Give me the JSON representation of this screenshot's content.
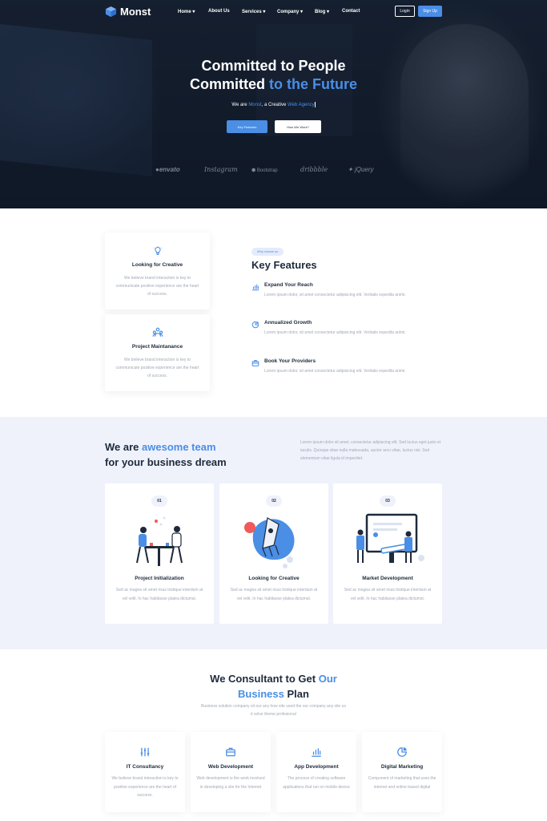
{
  "colors": {
    "accent": "#4a8ee5",
    "dark": "#1e2a3b",
    "muted": "#a0a8b5",
    "section_bg": "#eff2fb"
  },
  "brand": {
    "name": "Monst"
  },
  "nav": {
    "items": [
      {
        "label": "Home",
        "has_dropdown": true
      },
      {
        "label": "About Us",
        "has_dropdown": false
      },
      {
        "label": "Services",
        "has_dropdown": true
      },
      {
        "label": "Company",
        "has_dropdown": true
      },
      {
        "label": "Blog",
        "has_dropdown": true
      },
      {
        "label": "Contact",
        "has_dropdown": false
      }
    ],
    "login": "Login",
    "signup": "Sign Up"
  },
  "hero": {
    "line1": "Committed to People",
    "line2_plain": "Committed ",
    "line2_accent": "to the Future",
    "sub_pre": "We are ",
    "sub_brand": "Monst",
    "sub_mid": ", a Creative ",
    "sub_accent": "Web Agency",
    "btn_primary": "Key Features",
    "btn_secondary": "How We Work?",
    "partners": [
      "envato",
      "Instagram",
      "Bootstrap",
      "dribbble",
      "jQuery"
    ]
  },
  "features": {
    "cards": [
      {
        "icon": "lightbulb-icon",
        "title": "Looking for Creative",
        "text": "We believe brand interaction is key to communicate positive experience are the heart of success."
      },
      {
        "icon": "team-icon",
        "title": "Project Maintanance",
        "text": "We believe brand interaction is key to communicate positive experience are the heart of success."
      }
    ],
    "badge": "Why choose us",
    "title": "Key Features",
    "items": [
      {
        "icon": "bar-chart-icon",
        "title": "Expand Your Reach",
        "text": "Lorem ipsum dolor, sit amet consectetur adipisicing elit. Veritatis expedita animi."
      },
      {
        "icon": "pie-chart-icon",
        "title": "Annualized Growth",
        "text": "Lorem ipsum dolor, sit amet consectetur adipisicing elit. Veritatis expedita animi."
      },
      {
        "icon": "briefcase-icon",
        "title": "Book Your Providers",
        "text": "Lorem ipsum dolor, sit amet consectetur adipisicing elit. Veritatis expedita animi."
      }
    ]
  },
  "team": {
    "title_pre": "We are ",
    "title_accent": "awesome team",
    "title_line2": "for your business dream",
    "description": "Lorem ipsum dolor sit amet, consectetur adipiscing elit. Sed luctus eget justo et iaculis. Quisque vitae nulla malesuada, auctor arcu vitae, luctus nisi. Sed elementum vitae ligula id imperdiet.",
    "cards": [
      {
        "number": "01",
        "title": "Project Initialization",
        "text": "Sed ac magna sit amet risus tristique interdum at vel velit. In hac habitasse platea dictumst."
      },
      {
        "number": "02",
        "title": "Looking for Creative",
        "text": "Sed ac magna sit amet risus tristique interdum at vel velit. In hac habitasse platea dictumst."
      },
      {
        "number": "03",
        "title": "Market Development",
        "text": "Sed ac magna sit amet risus tristique interdum at vel velit. In hac habitasse platea dictumst."
      }
    ]
  },
  "consult": {
    "title_pre": "We Consultant to Get ",
    "title_accent1": "Our",
    "title_accent2": "Business",
    "title_post": " Plan",
    "description": "Business solution company sit our any how site used the our company any site us it solve theme profesional",
    "services": [
      {
        "icon": "sliders-icon",
        "title": "IT Consultancy",
        "text": "We believe brand interaction is key to positive experience are the heart of success."
      },
      {
        "icon": "briefcase-icon",
        "title": "Web Development",
        "text": "Web development is the work involved in developing a site for the Internet"
      },
      {
        "icon": "bar-chart-icon",
        "title": "App Development",
        "text": "The process of creating software applications that run on mobile device"
      },
      {
        "icon": "pie-chart-icon",
        "title": "Digital Marketing",
        "text": "Component of marketing that uses the internet and online based digital"
      }
    ]
  }
}
